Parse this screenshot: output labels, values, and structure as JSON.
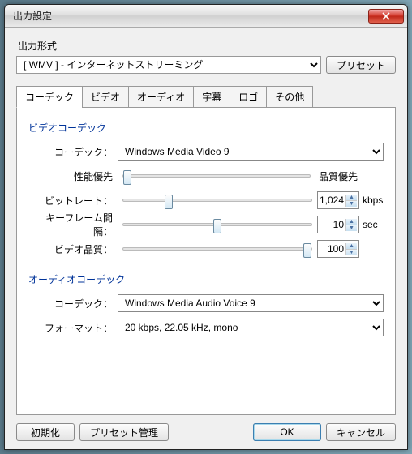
{
  "window": {
    "title": "出力設定"
  },
  "output_format": {
    "label": "出力形式",
    "selected": "[ WMV ] - インターネットストリーミング",
    "preset_btn": "プリセット"
  },
  "tabs": [
    {
      "label": "コーデック"
    },
    {
      "label": "ビデオ"
    },
    {
      "label": "オーディオ"
    },
    {
      "label": "字幕"
    },
    {
      "label": "ロゴ"
    },
    {
      "label": "その他"
    }
  ],
  "video_codec": {
    "title": "ビデオコーデック",
    "codec_label": "コーデック：",
    "codec_value": "Windows Media Video 9",
    "perf_label": "性能優先",
    "quality_label": "品質優先",
    "bitrate_label": "ビットレート：",
    "bitrate_value": "1,024",
    "bitrate_unit": "kbps",
    "keyframe_label": "キーフレーム間隔：",
    "keyframe_value": "10",
    "keyframe_unit": "sec",
    "quality2_label": "ビデオ品質：",
    "quality2_value": "100"
  },
  "audio_codec": {
    "title": "オーディオコーデック",
    "codec_label": "コーデック：",
    "codec_value": "Windows Media Audio Voice 9",
    "format_label": "フォーマット：",
    "format_value": "20 kbps, 22.05 kHz, mono"
  },
  "buttons": {
    "init": "初期化",
    "preset_mgr": "プリセット管理",
    "ok": "OK",
    "cancel": "キャンセル"
  }
}
